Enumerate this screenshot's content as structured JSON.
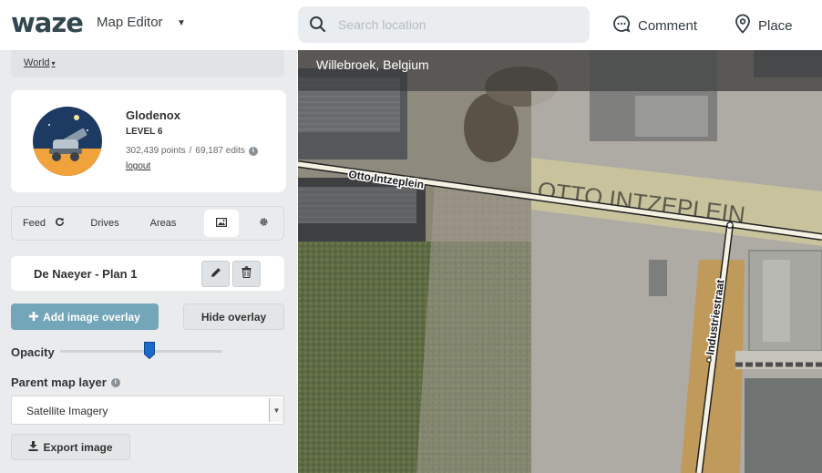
{
  "header": {
    "logo": "waze",
    "app_title": "Map Editor",
    "search_placeholder": "Search location",
    "comment_label": "Comment",
    "place_label": "Place"
  },
  "sidebar": {
    "world_link": "World",
    "profile": {
      "name": "Glodenox",
      "level": "LEVEL 6",
      "points": "302,439 points",
      "separator": "/",
      "edits": "69,187 edits",
      "logout": "logout"
    },
    "tabs": [
      {
        "label": "Feed",
        "icon": "refresh-icon"
      },
      {
        "label": "Drives"
      },
      {
        "label": "Areas"
      },
      {
        "label": "",
        "icon": "image-icon",
        "active": true
      },
      {
        "label": "",
        "icon": "gear-icon"
      }
    ],
    "plan": {
      "name": "De Naeyer - Plan 1"
    },
    "add_overlay_label": "Add image overlay",
    "hide_overlay_label": "Hide overlay",
    "opacity_label": "Opacity",
    "opacity_value": 0.55,
    "parent_layer_label": "Parent map layer",
    "parent_layer_value": "Satellite Imagery",
    "export_label": "Export image"
  },
  "map": {
    "location": "Willebroek, Belgium",
    "street_1": "Otto Intzeplein",
    "street_2": "Industriestraat",
    "overlay_text": "OTTO INTZEPLEIN"
  },
  "colors": {
    "brand": "#33474f",
    "accent_button": "#74a6ba",
    "sidebar_bg": "#e9ebed",
    "slider_thumb": "#1b6ac9"
  }
}
